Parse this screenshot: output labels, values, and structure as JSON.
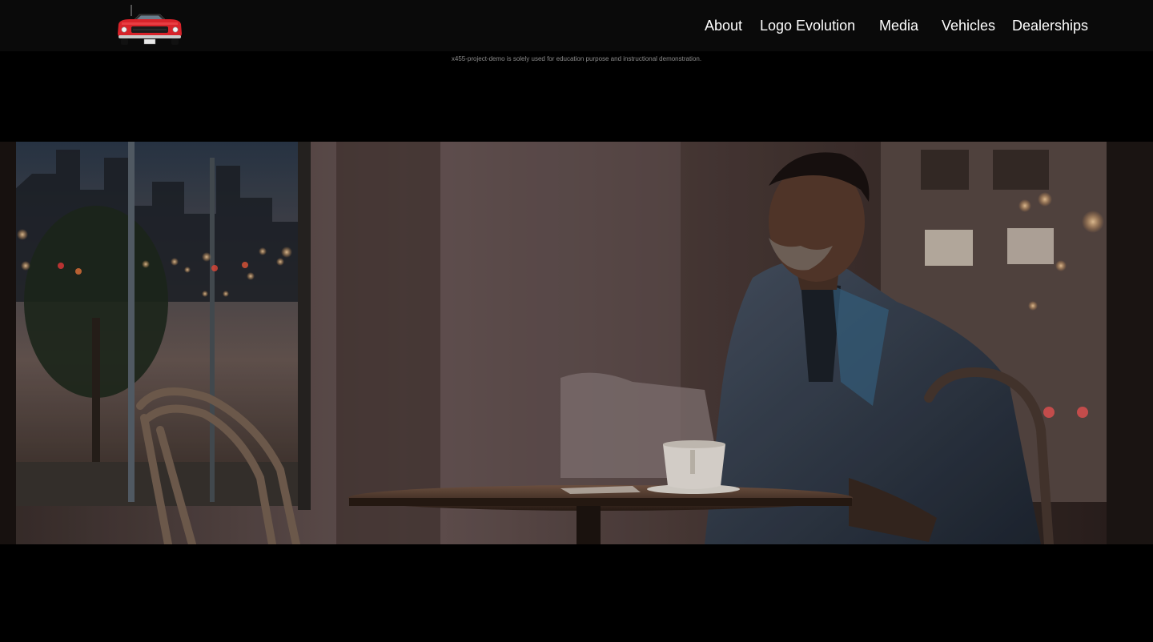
{
  "nav": {
    "links": [
      {
        "label": "About"
      },
      {
        "label": "Logo Evolution"
      },
      {
        "label": "Media"
      },
      {
        "label": "Vehicles"
      },
      {
        "label": "Dealerships"
      }
    ]
  },
  "disclaimer": "x455-project-demo is solely used for education purpose and instructional demonstration.",
  "colors": {
    "background": "#000000",
    "navbar": "#0a0a0a",
    "nav_text": "#ffffff",
    "car_red": "#d8232a"
  }
}
